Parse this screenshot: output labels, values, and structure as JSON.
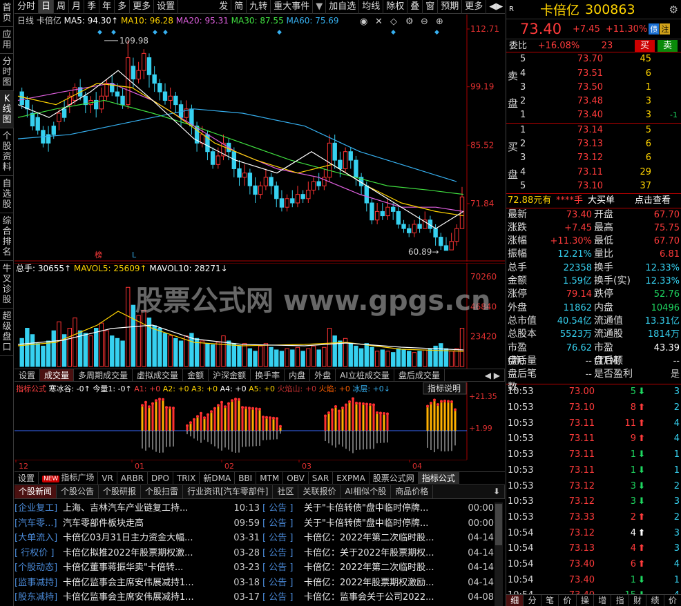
{
  "left_tabs": [
    "首页",
    "应用",
    "分时图",
    "K线图",
    "个股资料",
    "自选股",
    "综合排名",
    "牛叉诊股",
    "超级盘口"
  ],
  "toolbar": [
    "分时",
    "日",
    "周",
    "月",
    "季",
    "年",
    "多",
    "更多",
    "设置",
    "发",
    "简",
    "九转",
    "重大事件",
    "加自选",
    "均线",
    "除权",
    "叠",
    "窗",
    "预期",
    "更多"
  ],
  "toolbar_arrows": "◀▶",
  "ma_line": {
    "period": "日线",
    "name": "卡倍亿",
    "ma5": "MA5: 94.30",
    "ma10": "MA10: 96.28",
    "ma20": "MA20: 95.31",
    "ma30": "MA30: 87.55",
    "ma60": "MA60: 75.69"
  },
  "price_axis": [
    "112.71",
    "99.19",
    "85.52",
    "71.84"
  ],
  "price_hi_label": "109.98",
  "price_lo_label": "60.89",
  "markers": {
    "l1": "榜",
    "l2": "L"
  },
  "vol_header": {
    "a": "总手: 30655",
    "b": "MAVOL5: 25609",
    "c": "MAVOL10: 28271"
  },
  "vol_axis": [
    "70260",
    "46840",
    "23420"
  ],
  "watermark": "股票公式网  www.gpgs.cn",
  "vol_tabs": [
    "设置",
    "成交量",
    "多周期成交量",
    "虚拟成交量",
    "金额",
    "沪深金额",
    "换手率",
    "内盘",
    "外盘",
    "AI立桩成交量",
    "盘后成交量"
  ],
  "ind_header": {
    "a": "指标公式",
    "b": "寒冰谷: -0",
    "c": "今量1: -0",
    "d": "A1: +0",
    "e": "A2: +0",
    "f": "A3: +0",
    "g": "A4: +0",
    "h": "A5: +0",
    "i": "火焰山: +0",
    "j": "火焰: +0",
    "k": "冰层: +0"
  },
  "ind_explain": "指标说明",
  "ind_axis": [
    "+21.35",
    "+1.99"
  ],
  "x_axis": [
    "12",
    "01",
    "02",
    "03",
    "04"
  ],
  "ind_tabs": [
    "设置",
    "指标广场",
    "VR",
    "ARBR",
    "DPO",
    "TRIX",
    "新DMA",
    "BBI",
    "MTM",
    "OBV",
    "SAR",
    "EXPMA",
    "股票公式网",
    "指标公式"
  ],
  "new_badge": "NEW",
  "news_tabs": [
    "个股新闻",
    "个股公告",
    "个股研报",
    "个股扫雷",
    "行业资讯[汽车零部件]",
    "社区",
    "关联报价",
    "AI相似个股",
    "商品价格"
  ],
  "news_left": [
    {
      "tag": "[企业复工]",
      "title": "上海、吉林汽车产业链复工持...",
      "time": "10:13"
    },
    {
      "tag": "[汽车零...]",
      "title": "汽车零部件板块走高",
      "time": "09:59"
    },
    {
      "tag": "[大单流入]",
      "title": "卡倍亿03月31日主力资金大幅...",
      "time": "03-31"
    },
    {
      "tag": "[ 行权价 ]",
      "title": "卡倍亿拟推2022年股票期权激...",
      "time": "03-28"
    },
    {
      "tag": "[个股动态]",
      "title": "卡倍亿董事蒋振华卖\"卡倍转...",
      "time": "03-23"
    },
    {
      "tag": "[监事减持]",
      "title": "卡倍亿监事会主席安伟展减持1...",
      "time": "03-18"
    },
    {
      "tag": "[股东减持]",
      "title": "卡倍亿监事会主席安伟展减持1...",
      "time": "03-17"
    }
  ],
  "news_right": [
    {
      "tag": "[  公告  ]",
      "title": "关于\"卡倍转债\"盘中临时停牌...",
      "time": "00:00"
    },
    {
      "tag": "[  公告  ]",
      "title": "关于\"卡倍转债\"盘中临时停牌...",
      "time": "00:00"
    },
    {
      "tag": "[  公告  ]",
      "title": "卡倍亿：2022年第二次临时股...",
      "time": "04-14"
    },
    {
      "tag": "[  公告  ]",
      "title": "卡倍亿：关于2022年股票期权...",
      "time": "04-14"
    },
    {
      "tag": "[  公告  ]",
      "title": "卡倍亿：2022年第二次临时股...",
      "time": "04-14"
    },
    {
      "tag": "[  公告  ]",
      "title": "卡倍亿：2022年股票期权激励...",
      "time": "04-14"
    },
    {
      "tag": "[  公告  ]",
      "title": "卡倍亿：监事会关于公司2022...",
      "time": "04-08"
    }
  ],
  "quote": {
    "r": "R",
    "name": "卡倍亿",
    "code": "300863",
    "price": "73.40",
    "change": "+7.45",
    "pct": "+11.30%",
    "tag1": "债",
    "tag2": "注",
    "wb_label": "委比",
    "wb": "+16.08%",
    "wc": "23",
    "buy_btn": "买",
    "sell_btn": "卖"
  },
  "sell_side": "卖盘",
  "buy_side": "买盘",
  "asks": [
    {
      "n": "5",
      "p": "73.70",
      "v": "45",
      "d": ""
    },
    {
      "n": "4",
      "p": "73.51",
      "v": "6",
      "d": ""
    },
    {
      "n": "3",
      "p": "73.50",
      "v": "1",
      "d": ""
    },
    {
      "n": "2",
      "p": "73.48",
      "v": "3",
      "d": ""
    },
    {
      "n": "1",
      "p": "73.40",
      "v": "3",
      "d": "-1"
    }
  ],
  "bids": [
    {
      "n": "1",
      "p": "73.14",
      "v": "5",
      "d": ""
    },
    {
      "n": "2",
      "p": "73.13",
      "v": "6",
      "d": ""
    },
    {
      "n": "3",
      "p": "73.12",
      "v": "6",
      "d": ""
    },
    {
      "n": "4",
      "p": "73.11",
      "v": "29",
      "d": ""
    },
    {
      "n": "5",
      "p": "73.10",
      "v": "37",
      "d": ""
    }
  ],
  "big": {
    "a": "72.88元有",
    "b": "****手",
    "c": "大买单",
    "d": "点击查看"
  },
  "stats": [
    [
      "最新",
      "73.40",
      "开盘",
      "67.70"
    ],
    [
      "涨跌",
      "+7.45",
      "最高",
      "75.75"
    ],
    [
      "涨幅",
      "+11.30%",
      "最低",
      "67.70"
    ],
    [
      "振幅",
      "12.21%",
      "量比",
      "6.81"
    ],
    [
      "总手",
      "22358",
      "换手",
      "12.33%"
    ],
    [
      "金额",
      "1.59亿",
      "换手(实)",
      "12.33%"
    ],
    [
      "涨停",
      "79.14",
      "跌停",
      "52.76"
    ],
    [
      "外盘",
      "11862",
      "内盘",
      "10496"
    ],
    [
      "总市值",
      "40.54亿",
      "流通值",
      "13.31亿"
    ],
    [
      "总股本",
      "5523万",
      "流通股",
      "1814万"
    ],
    [
      "市盈(静)",
      "76.62",
      "市盈(TTM)",
      "43.39"
    ],
    [
      "盘后量",
      "--",
      "盘后额",
      "--"
    ],
    [
      "盘后笔数",
      "--",
      "是否盈利",
      "是"
    ]
  ],
  "ticks": [
    {
      "t": "10:53",
      "p": "73.00",
      "v": "5",
      "d": "dn",
      "n": "3"
    },
    {
      "t": "10:53",
      "p": "73.10",
      "v": "8",
      "d": "up",
      "n": "2"
    },
    {
      "t": "10:53",
      "p": "73.11",
      "v": "11",
      "d": "up",
      "n": "4"
    },
    {
      "t": "10:53",
      "p": "73.11",
      "v": "9",
      "d": "up",
      "n": "4"
    },
    {
      "t": "10:53",
      "p": "73.11",
      "v": "1",
      "d": "dn",
      "n": "1"
    },
    {
      "t": "10:53",
      "p": "73.11",
      "v": "1",
      "d": "dn",
      "n": "1"
    },
    {
      "t": "10:53",
      "p": "73.12",
      "v": "3",
      "d": "dn",
      "n": "2"
    },
    {
      "t": "10:53",
      "p": "73.12",
      "v": "3",
      "d": "dn",
      "n": "3"
    },
    {
      "t": "10:53",
      "p": "73.33",
      "v": "2",
      "d": "up",
      "n": "2"
    },
    {
      "t": "10:54",
      "p": "73.12",
      "v": "4",
      "d": "wu",
      "n": "3"
    },
    {
      "t": "10:54",
      "p": "73.13",
      "v": "4",
      "d": "up",
      "n": "3"
    },
    {
      "t": "10:54",
      "p": "73.40",
      "v": "6",
      "d": "up",
      "n": "4"
    },
    {
      "t": "10:54",
      "p": "73.40",
      "v": "1",
      "d": "dn",
      "n": "1"
    },
    {
      "t": "10:54",
      "p": "73.40",
      "v": "15",
      "d": "dn",
      "n": "4"
    }
  ],
  "bottom_tabs": [
    "细",
    "分",
    "笔",
    "价",
    "操",
    "增",
    "指",
    "财",
    "绩",
    "价"
  ]
}
